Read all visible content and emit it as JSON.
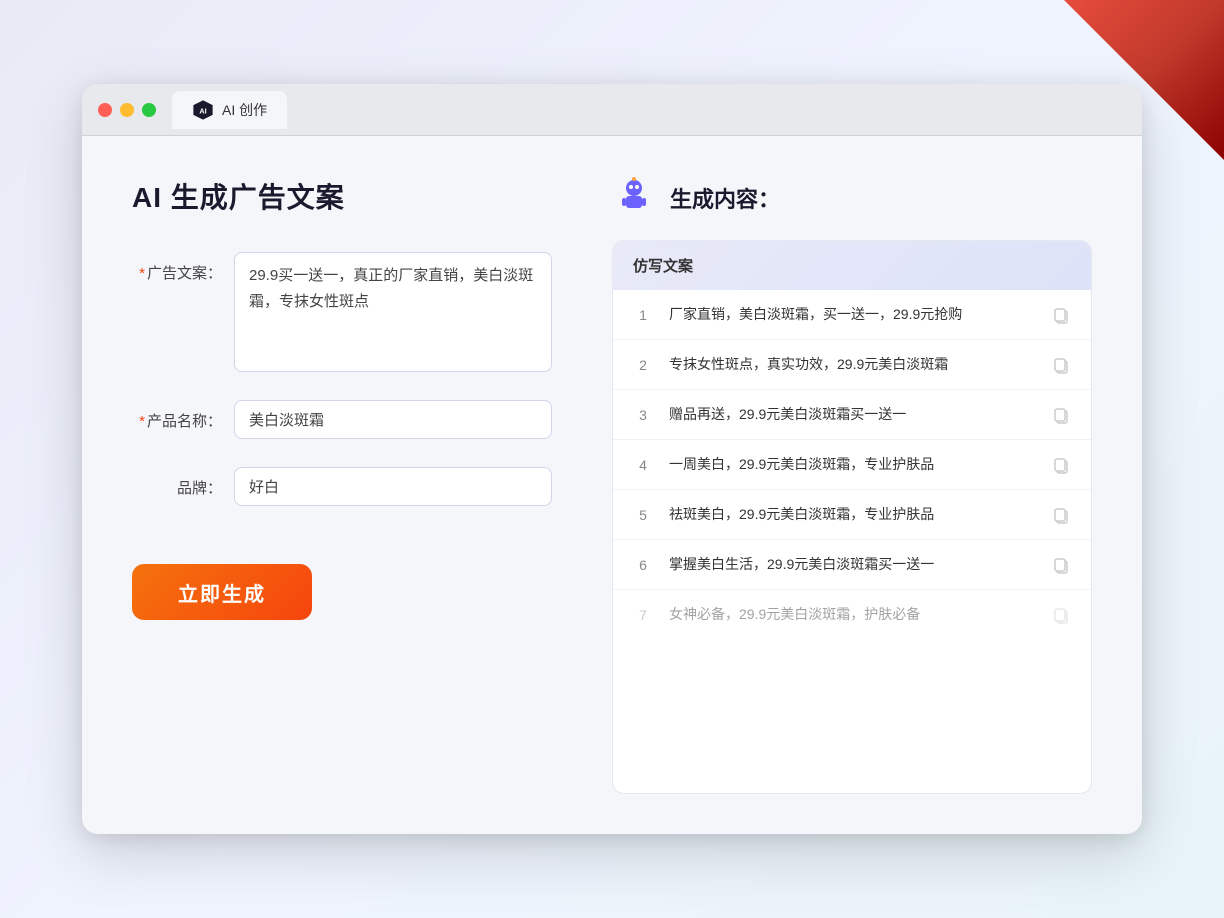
{
  "decoration": {
    "corner": true
  },
  "browser": {
    "tab_label": "AI 创作",
    "controls": {
      "close": "close",
      "minimize": "minimize",
      "maximize": "maximize"
    }
  },
  "left_panel": {
    "title": "AI 生成广告文案",
    "form": {
      "ad_copy_label": "广告文案：",
      "ad_copy_required": "*",
      "ad_copy_value": "29.9买一送一，真正的厂家直销，美白淡斑霜，专抹女性斑点",
      "product_name_label": "产品名称：",
      "product_name_required": "*",
      "product_name_value": "美白淡斑霜",
      "brand_label": "品牌：",
      "brand_value": "好白"
    },
    "generate_button": "立即生成"
  },
  "right_panel": {
    "title": "生成内容：",
    "results_header": "仿写文案",
    "results": [
      {
        "num": "1",
        "text": "厂家直销，美白淡斑霜，买一送一，29.9元抢购",
        "dimmed": false
      },
      {
        "num": "2",
        "text": "专抹女性斑点，真实功效，29.9元美白淡斑霜",
        "dimmed": false
      },
      {
        "num": "3",
        "text": "赠品再送，29.9元美白淡斑霜买一送一",
        "dimmed": false
      },
      {
        "num": "4",
        "text": "一周美白，29.9元美白淡斑霜，专业护肤品",
        "dimmed": false
      },
      {
        "num": "5",
        "text": "祛斑美白，29.9元美白淡斑霜，专业护肤品",
        "dimmed": false
      },
      {
        "num": "6",
        "text": "掌握美白生活，29.9元美白淡斑霜买一送一",
        "dimmed": false
      },
      {
        "num": "7",
        "text": "女神必备，29.9元美白淡斑霜，护肤必备",
        "dimmed": true
      }
    ]
  }
}
